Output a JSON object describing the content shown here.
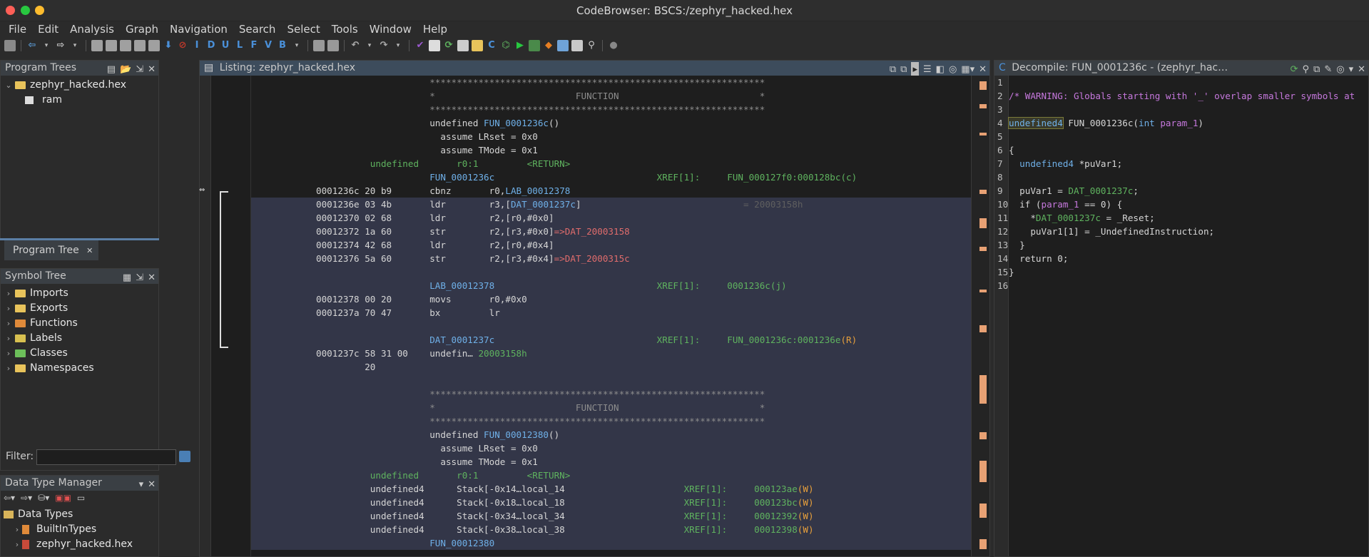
{
  "app": {
    "title": "CodeBrowser: BSCS:/zephyr_hacked.hex"
  },
  "menu": [
    "File",
    "Edit",
    "Analysis",
    "Graph",
    "Navigation",
    "Search",
    "Select",
    "Tools",
    "Window",
    "Help"
  ],
  "toolbar_letters": [
    "I",
    "D",
    "U",
    "L",
    "F",
    "V",
    "B"
  ],
  "program_trees": {
    "title": "Program Trees",
    "root": "zephyr_hacked.hex",
    "child": "ram",
    "tab": "Program Tree"
  },
  "symbol_tree": {
    "title": "Symbol Tree",
    "items": [
      "Imports",
      "Exports",
      "Functions",
      "Labels",
      "Classes",
      "Namespaces"
    ]
  },
  "filter": {
    "label": "Filter:",
    "value": ""
  },
  "dtm": {
    "title": "Data Type Manager",
    "items": [
      "Data Types",
      "BuiltInTypes",
      "zephyr_hacked.hex"
    ]
  },
  "listing": {
    "title": "Listing:  zephyr_hacked.hex",
    "lines": [
      {
        "cls": "",
        "parts": [
          [
            "#8c8c8c",
            "                                 **************************************************************"
          ]
        ]
      },
      {
        "cls": "",
        "parts": [
          [
            "#8c8c8c",
            "                                 *                          FUNCTION                          *"
          ]
        ]
      },
      {
        "cls": "",
        "parts": [
          [
            "#8c8c8c",
            "                                 **************************************************************"
          ]
        ]
      },
      {
        "cls": "",
        "parts": [
          [
            "#d6d6d6",
            "                                 undefined "
          ],
          [
            "#6fb0e8",
            "FUN_0001236c"
          ],
          [
            "#d6d6d6",
            "()"
          ]
        ]
      },
      {
        "cls": "",
        "parts": [
          [
            "#d6d6d6",
            "                                   assume LRset = 0x0"
          ]
        ]
      },
      {
        "cls": "",
        "parts": [
          [
            "#d6d6d6",
            "                                   assume TMode = 0x1"
          ]
        ]
      },
      {
        "cls": "",
        "parts": [
          [
            "#5fb35f",
            "                      undefined       r0:1         <RETURN>"
          ]
        ]
      },
      {
        "cls": "",
        "parts": [
          [
            "#6fb0e8",
            "                                 FUN_0001236c"
          ],
          [
            "#5fb35f",
            "                              XREF[1]:     "
          ],
          [
            "#5fb35f",
            "FUN_000127f0:000128bc(c)"
          ]
        ]
      },
      {
        "cls": "",
        "parts": [
          [
            "#d6d6d6",
            "            0001236c 20 b9       "
          ],
          [
            "#d6d6d6",
            "cbnz       r0,"
          ],
          [
            "#6fb0e8",
            "LAB_00012378"
          ]
        ]
      },
      {
        "cls": "hl",
        "parts": [
          [
            "#d6d6d6",
            "            0001236e 03 4b       ldr        r3,["
          ],
          [
            "#6fb0e8",
            "DAT_0001237c"
          ],
          [
            "#d6d6d6",
            "]"
          ],
          [
            "#5f5f5f",
            "                              = 20003158h"
          ]
        ]
      },
      {
        "cls": "hl",
        "parts": [
          [
            "#d6d6d6",
            "            00012370 02 68       ldr        r2,[r0,#0x0]"
          ]
        ]
      },
      {
        "cls": "hl",
        "parts": [
          [
            "#d6d6d6",
            "            00012372 1a 60       str        r2,[r3,#0x0]"
          ],
          [
            "#e06c6c",
            "=>DAT_20003158"
          ]
        ]
      },
      {
        "cls": "hl",
        "parts": [
          [
            "#d6d6d6",
            "            00012374 42 68       ldr        r2,[r0,#0x4]"
          ]
        ]
      },
      {
        "cls": "hl",
        "parts": [
          [
            "#d6d6d6",
            "            00012376 5a 60       str        r2,[r3,#0x4]"
          ],
          [
            "#e06c6c",
            "=>DAT_2000315c"
          ]
        ]
      },
      {
        "cls": "hl",
        "parts": [
          [
            "#d6d6d6",
            ""
          ]
        ]
      },
      {
        "cls": "hl",
        "parts": [
          [
            "#6fb0e8",
            "                                 LAB_00012378"
          ],
          [
            "#5fb35f",
            "                              XREF[1]:     "
          ],
          [
            "#5fb35f",
            "0001236c(j)"
          ]
        ]
      },
      {
        "cls": "hl",
        "parts": [
          [
            "#d6d6d6",
            "            00012378 00 20       movs       r0,#0x0"
          ]
        ]
      },
      {
        "cls": "hl",
        "parts": [
          [
            "#d6d6d6",
            "            0001237a 70 47       bx         lr"
          ]
        ]
      },
      {
        "cls": "hl",
        "parts": [
          [
            "#d6d6d6",
            ""
          ]
        ]
      },
      {
        "cls": "hl",
        "parts": [
          [
            "#6fb0e8",
            "                                 DAT_0001237c"
          ],
          [
            "#5fb35f",
            "                              XREF[1]:     "
          ],
          [
            "#5fb35f",
            "FUN_0001236c:0001236e"
          ],
          [
            "#e8a03c",
            "(R)"
          ]
        ]
      },
      {
        "cls": "hl",
        "parts": [
          [
            "#d6d6d6",
            "            0001237c 58 31 00    undefin… "
          ],
          [
            "#5fb35f",
            "20003158h"
          ]
        ]
      },
      {
        "cls": "hl",
        "parts": [
          [
            "#d6d6d6",
            "                     20"
          ]
        ]
      },
      {
        "cls": "hl",
        "parts": [
          [
            "#d6d6d6",
            ""
          ]
        ]
      },
      {
        "cls": "hl",
        "parts": [
          [
            "#8c8c8c",
            "                                 **************************************************************"
          ]
        ]
      },
      {
        "cls": "hl",
        "parts": [
          [
            "#8c8c8c",
            "                                 *                          FUNCTION                          *"
          ]
        ]
      },
      {
        "cls": "hl",
        "parts": [
          [
            "#8c8c8c",
            "                                 **************************************************************"
          ]
        ]
      },
      {
        "cls": "hl",
        "parts": [
          [
            "#d6d6d6",
            "                                 undefined "
          ],
          [
            "#6fb0e8",
            "FUN_00012380"
          ],
          [
            "#d6d6d6",
            "()"
          ]
        ]
      },
      {
        "cls": "hl",
        "parts": [
          [
            "#d6d6d6",
            "                                   assume LRset = 0x0"
          ]
        ]
      },
      {
        "cls": "hl",
        "parts": [
          [
            "#d6d6d6",
            "                                   assume TMode = 0x1"
          ]
        ]
      },
      {
        "cls": "hl",
        "parts": [
          [
            "#5fb35f",
            "                      undefined       r0:1         <RETURN>"
          ]
        ]
      },
      {
        "cls": "hl",
        "parts": [
          [
            "#d6d6d6",
            "                      undefined4      Stack[-0x14…local_14"
          ],
          [
            "#5fb35f",
            "                      XREF[1]:     000123ae"
          ],
          [
            "#e8a03c",
            "(W)"
          ]
        ]
      },
      {
        "cls": "hl",
        "parts": [
          [
            "#d6d6d6",
            "                      undefined4      Stack[-0x18…local_18"
          ],
          [
            "#5fb35f",
            "                      XREF[1]:     000123bc"
          ],
          [
            "#e8a03c",
            "(W)"
          ]
        ]
      },
      {
        "cls": "hl",
        "parts": [
          [
            "#d6d6d6",
            "                      undefined4      Stack[-0x34…local_34"
          ],
          [
            "#5fb35f",
            "                      XREF[1]:     00012392"
          ],
          [
            "#e8a03c",
            "(W)"
          ]
        ]
      },
      {
        "cls": "hl",
        "parts": [
          [
            "#d6d6d6",
            "                      undefined4      Stack[-0x38…local_38"
          ],
          [
            "#5fb35f",
            "                      XREF[1]:     00012398"
          ],
          [
            "#e8a03c",
            "(W)"
          ]
        ]
      },
      {
        "cls": "hl",
        "parts": [
          [
            "#6fb0e8",
            "                                 FUN_00012380"
          ]
        ]
      }
    ]
  },
  "decompile": {
    "title": "Decompile: FUN_0001236c - (zephyr_hac…",
    "lines": [
      {
        "n": "1",
        "parts": []
      },
      {
        "n": "2",
        "parts": [
          [
            "#c678dd",
            "/* WARNING: Globals starting with '_' overlap smaller symbols at"
          ]
        ]
      },
      {
        "n": "3",
        "parts": []
      },
      {
        "n": "4",
        "parts": [
          [
            "#6fb0e8",
            "undefined4"
          ],
          [
            "#d6d6d6",
            " FUN_0001236c("
          ],
          [
            "#6fb0e8",
            "int"
          ],
          [
            "#d6d6d6",
            " "
          ],
          [
            "#c678dd",
            "param_1"
          ],
          [
            "#d6d6d6",
            ")"
          ]
        ]
      },
      {
        "n": "5",
        "parts": []
      },
      {
        "n": "6",
        "parts": [
          [
            "#d6d6d6",
            "{"
          ]
        ]
      },
      {
        "n": "7",
        "parts": [
          [
            "#6fb0e8",
            "  undefined4"
          ],
          [
            "#d6d6d6",
            " *puVar1;"
          ]
        ]
      },
      {
        "n": "8",
        "parts": []
      },
      {
        "n": "9",
        "parts": [
          [
            "#d6d6d6",
            "  puVar1 = "
          ],
          [
            "#5fb35f",
            "DAT_0001237c"
          ],
          [
            "#d6d6d6",
            ";"
          ]
        ]
      },
      {
        "n": "10",
        "parts": [
          [
            "#d6d6d6",
            "  if ("
          ],
          [
            "#c678dd",
            "param_1"
          ],
          [
            "#d6d6d6",
            " == 0) {"
          ]
        ]
      },
      {
        "n": "11",
        "parts": [
          [
            "#d6d6d6",
            "    *"
          ],
          [
            "#5fb35f",
            "DAT_0001237c"
          ],
          [
            "#d6d6d6",
            " = _Reset;"
          ]
        ]
      },
      {
        "n": "12",
        "parts": [
          [
            "#d6d6d6",
            "    puVar1[1] = _UndefinedInstruction;"
          ]
        ]
      },
      {
        "n": "13",
        "parts": [
          [
            "#d6d6d6",
            "  }"
          ]
        ]
      },
      {
        "n": "14",
        "parts": [
          [
            "#d6d6d6",
            "  return 0;"
          ]
        ]
      },
      {
        "n": "15",
        "parts": [
          [
            "#d6d6d6",
            "}"
          ]
        ]
      },
      {
        "n": "16",
        "parts": []
      }
    ]
  }
}
